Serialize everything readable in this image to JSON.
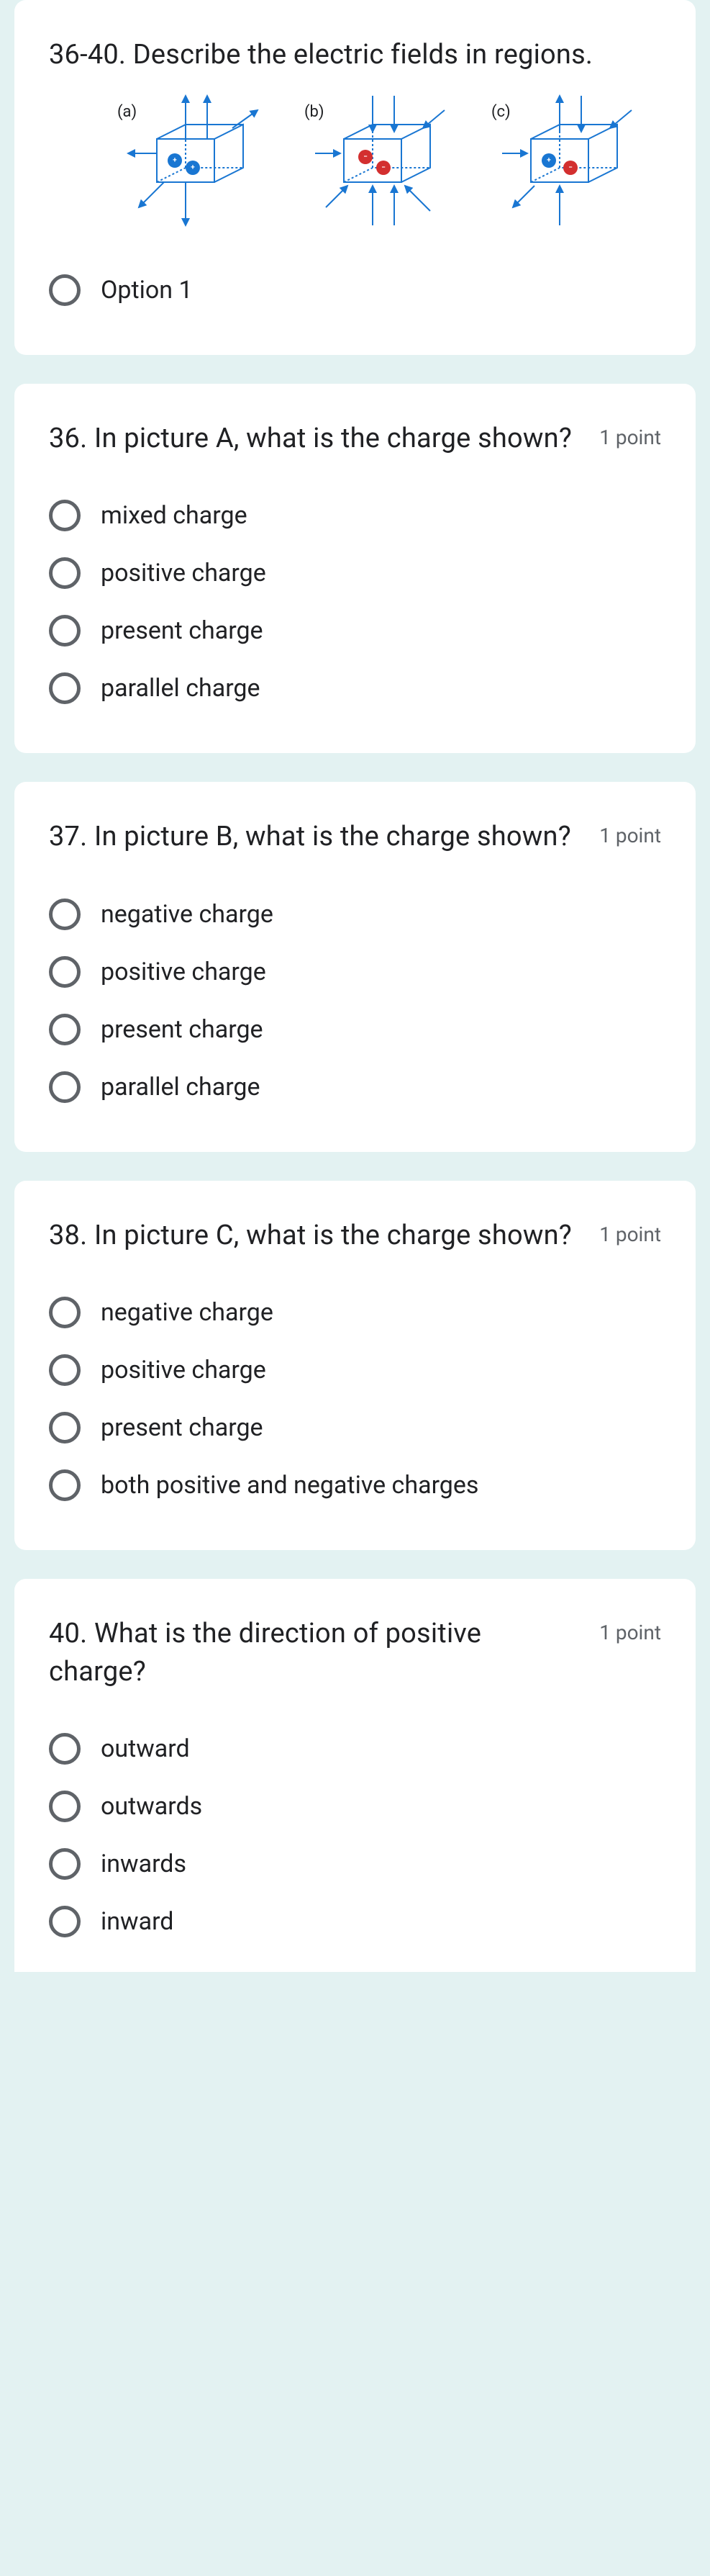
{
  "intro": {
    "title": "36-40. Describe the electric fields in regions.",
    "option1": "Option 1",
    "labels": {
      "a": "(a)",
      "b": "(b)",
      "c": "(c)"
    }
  },
  "q36": {
    "title": "36. In picture A, what is the charge shown?",
    "points": "1 point",
    "options": [
      "mixed charge",
      "positive charge",
      "present charge",
      "parallel charge"
    ]
  },
  "q37": {
    "title": "37. In picture B, what is the charge shown?",
    "points": "1 point",
    "options": [
      "negative charge",
      "positive charge",
      "present charge",
      "parallel charge"
    ]
  },
  "q38": {
    "title": "38. In picture C, what is the charge shown?",
    "points": "1 point",
    "options": [
      "negative charge",
      "positive charge",
      "present charge",
      "both positive and negative charges"
    ]
  },
  "q40": {
    "title": "40. What is the direction of positive charge?",
    "points": "1 point",
    "options": [
      "outward",
      "outwards",
      "inwards",
      "inward"
    ]
  }
}
